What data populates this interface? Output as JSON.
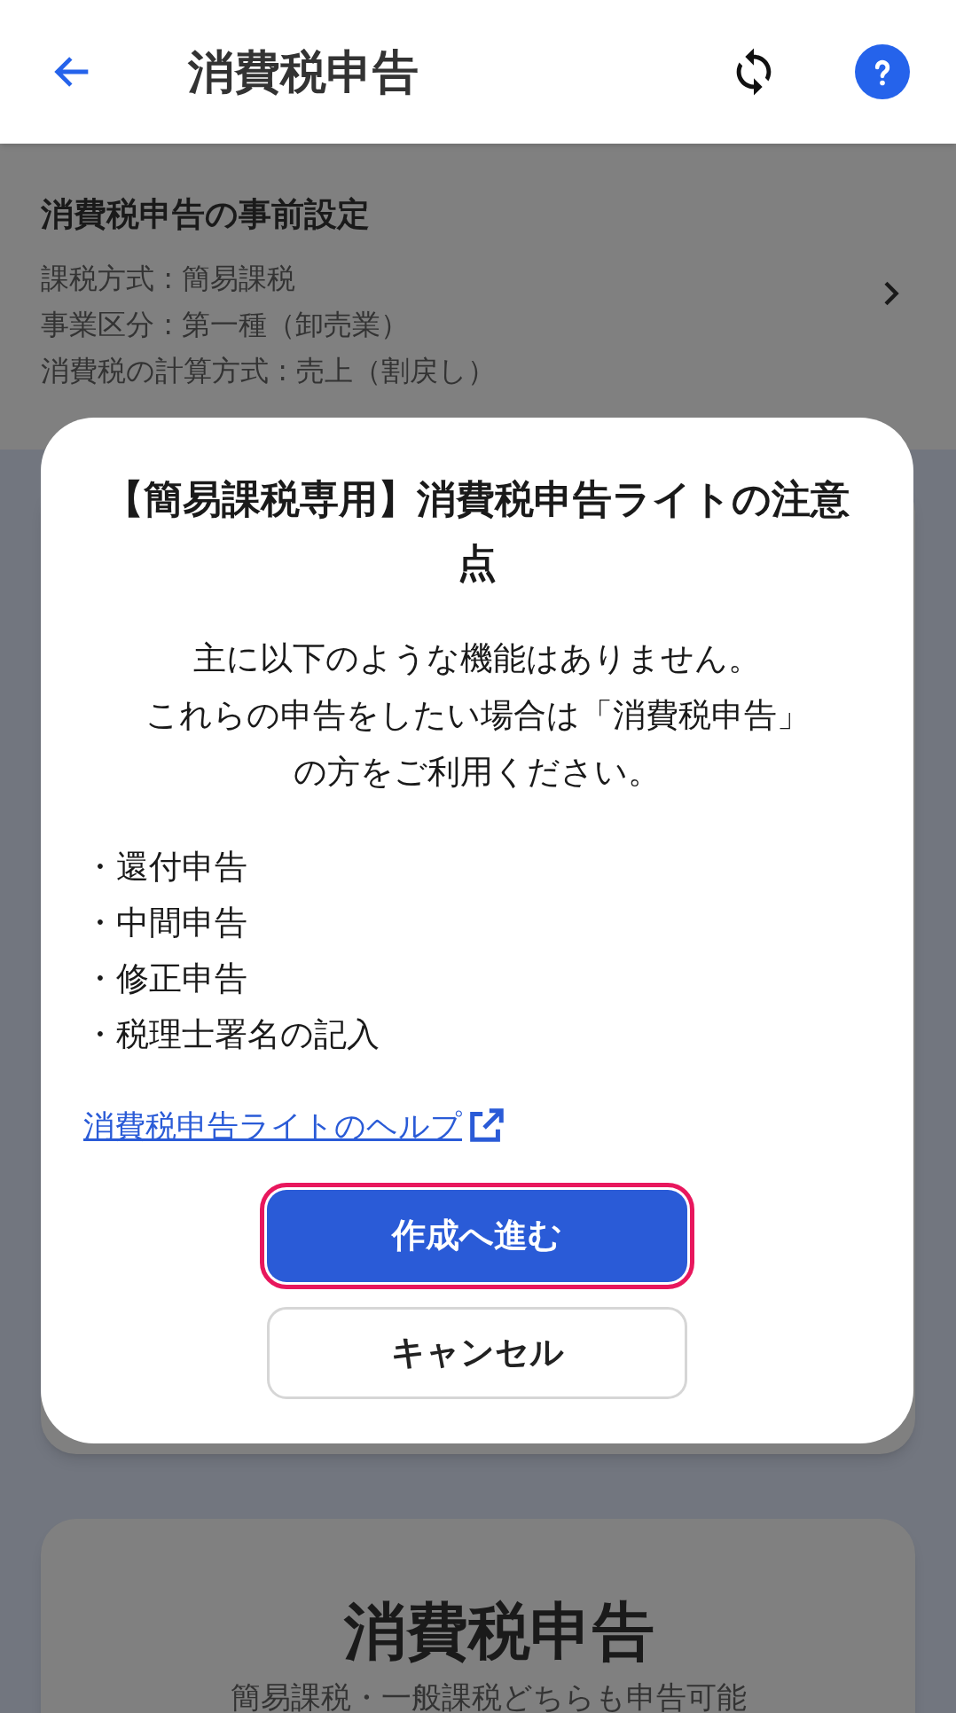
{
  "header": {
    "title": "消費税申告"
  },
  "settings": {
    "title": "消費税申告の事前設定",
    "lines": [
      "課税方式 : 簡易課税",
      "事業区分 : 第一種（卸売業）",
      "消費税の計算方式 : 売上（割戻し）"
    ]
  },
  "dialog": {
    "title": "【簡易課税専用】消費税申告ライトの注意点",
    "message_lines": [
      "主に以下のような機能はありません。",
      "これらの申告をしたい場合は「消費税申告」",
      "の方をご利用ください。"
    ],
    "items": [
      "・還付申告",
      "・中間申告",
      "・修正申告",
      "・税理士署名の記入"
    ],
    "help_link": "消費税申告ライトのヘルプ",
    "buttons": [
      {
        "label": "作成へ進む",
        "kind": "primary",
        "focused": true
      },
      {
        "label": "キャンセル",
        "kind": "secondary",
        "focused": false
      }
    ]
  },
  "bottom_card": {
    "title": "消費税申告",
    "subtitle": "簡易課税・一般課税どちらも申告可能"
  }
}
